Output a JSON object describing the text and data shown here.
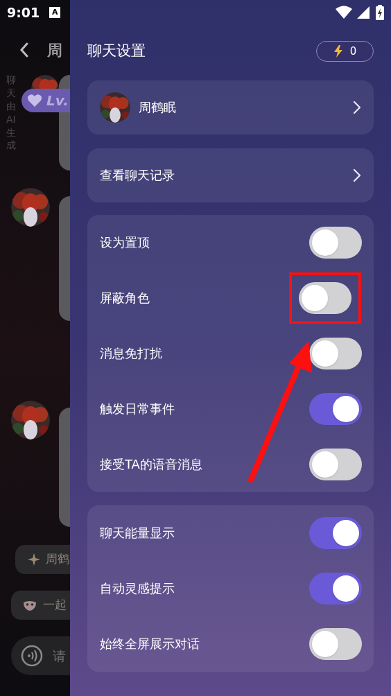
{
  "status_bar": {
    "time": "9:01",
    "notification_icon": "A"
  },
  "chat_background": {
    "title": "周",
    "ai_notice": "聊天由AI生成",
    "level_badge": "Lv.",
    "suggestions": [
      {
        "kind": "sparkle",
        "label": "周鹤"
      },
      {
        "kind": "mask",
        "label": "一起"
      }
    ],
    "input": {
      "placeholder": "请"
    }
  },
  "drawer": {
    "title": "聊天设置",
    "energy": "0",
    "profile": {
      "name": "周鹤眠"
    },
    "history": {
      "label": "查看聊天记录"
    },
    "groups": [
      [
        {
          "label": "设为置顶",
          "on": false
        },
        {
          "label": "屏蔽角色",
          "on": false,
          "highlighted": true
        },
        {
          "label": "消息免打扰",
          "on": false
        },
        {
          "label": "触发日常事件",
          "on": true
        },
        {
          "label": "接受TA的语音消息",
          "on": false
        }
      ],
      [
        {
          "label": "聊天能量显示",
          "on": true
        },
        {
          "label": "自动灵感提示",
          "on": true
        },
        {
          "label": "始终全屏展示对话",
          "on": false
        }
      ]
    ]
  }
}
